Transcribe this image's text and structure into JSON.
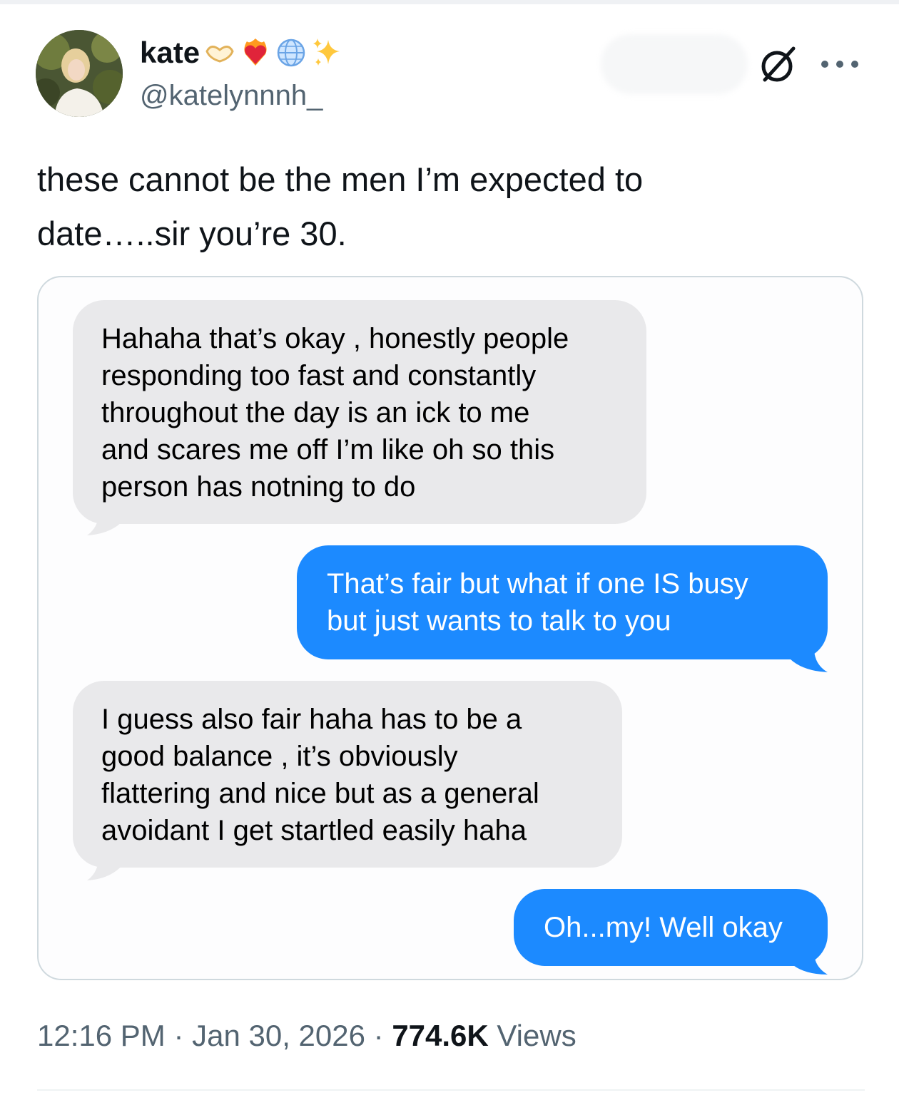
{
  "author": {
    "name": "kate",
    "handle": "@katelynnnh_",
    "name_emojis": [
      "heart-hands-emoji",
      "heart-on-fire-emoji",
      "globe-emoji",
      "sparkles-emoji"
    ]
  },
  "header_icons": [
    "grok-icon",
    "more-icon"
  ],
  "tweet": {
    "text_lines": [
      "these cannot be the men I’m expected to",
      "date…..sir you’re 30."
    ]
  },
  "media": {
    "messages": [
      {
        "direction": "received",
        "lines": [
          "Hahaha that’s okay , honestly people",
          "responding too fast and constantly",
          "throughout the day is an ick to me",
          "and scares me off I’m like oh so this",
          "person has notning to do"
        ]
      },
      {
        "direction": "sent",
        "lines": [
          "That’s fair but what if one IS busy",
          "but just wants to talk to you"
        ]
      },
      {
        "direction": "received",
        "lines": [
          "I guess also fair haha has to be a",
          "good balance , it’s obviously",
          "flattering and nice but as a general",
          "avoidant I get startled easily haha"
        ]
      },
      {
        "direction": "sent",
        "lines": [
          "Oh...my! Well okay"
        ]
      }
    ],
    "colors": {
      "received_bubble": "#e9e9eb",
      "sent_bubble": "#1c8aff"
    }
  },
  "meta": {
    "time": "12:16 PM",
    "separator": " · ",
    "date": "Jan 30, 2026",
    "views_count": "774.6K",
    "views_label": " Views"
  }
}
